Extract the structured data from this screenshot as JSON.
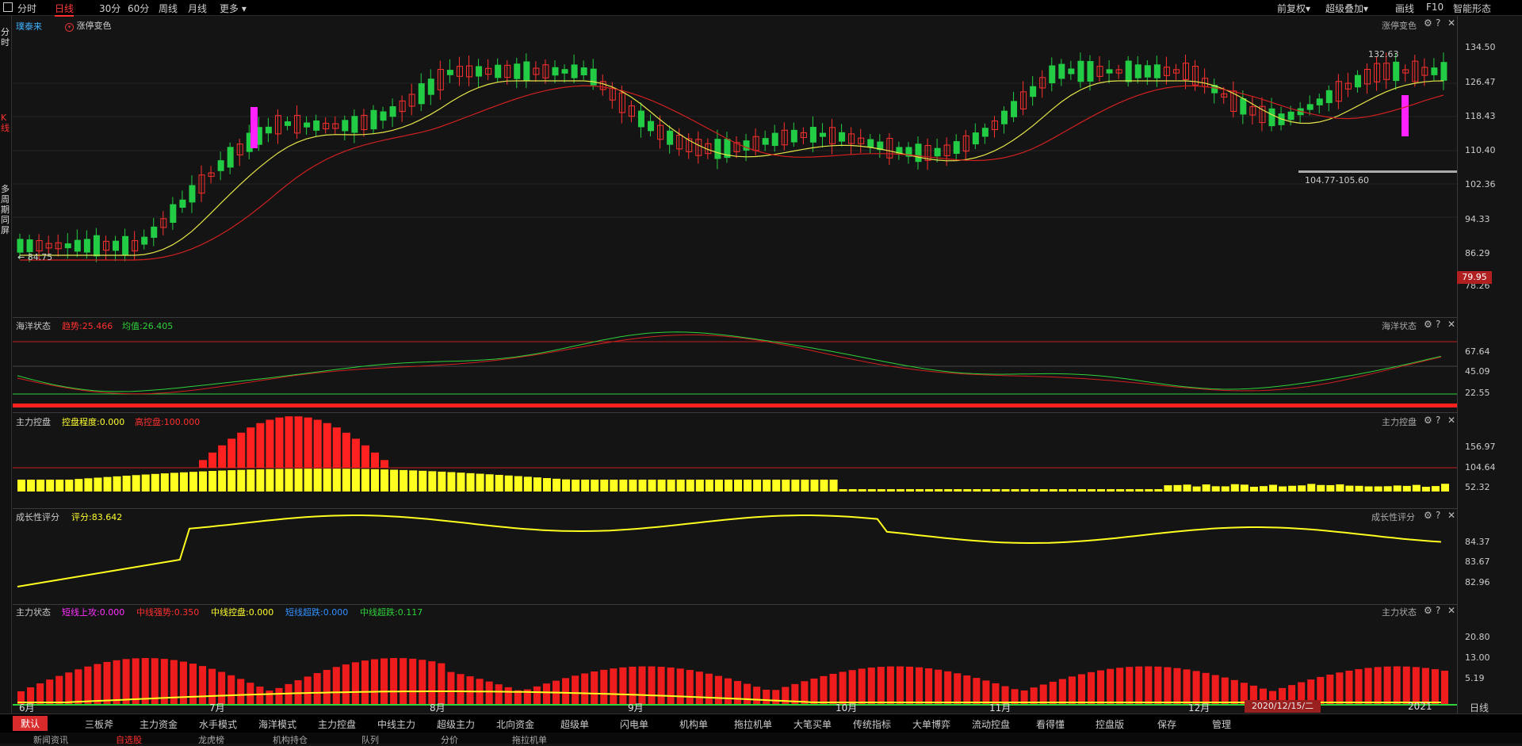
{
  "toolbar": {
    "periods": [
      "分时",
      "日线",
      "30分",
      "60分",
      "周线",
      "月线",
      "更多"
    ],
    "active_period": "日线",
    "right": [
      "前复权",
      "超级叠加",
      "画线",
      "F10",
      "智能形态"
    ]
  },
  "left_strip": {
    "items": [
      "分时",
      "K线",
      "多周期同屏"
    ]
  },
  "main_panel": {
    "name": "璞泰来",
    "indicator": "涨停变色",
    "right_title": "涨停变色",
    "high_label": "132.63",
    "low_label": "84.75",
    "range_label": "104.77-105.60",
    "price_tag": "79.95",
    "y_ticks": [
      "134.50",
      "126.47",
      "118.43",
      "110.40",
      "102.36",
      "94.33",
      "86.29",
      "78.26"
    ]
  },
  "panel2": {
    "title": "海洋状态",
    "items": [
      {
        "label": "趋势:25.466",
        "color": "#ff3030"
      },
      {
        "label": "均值:26.405",
        "color": "#2ed23a"
      }
    ],
    "right_title": "海洋状态",
    "y_ticks": [
      "67.64",
      "45.09",
      "22.55"
    ]
  },
  "panel3": {
    "title": "主力控盘",
    "items": [
      {
        "label": "控盘程度:0.000",
        "color": "#ffff30"
      },
      {
        "label": "高控盘:100.000",
        "color": "#ff3030"
      }
    ],
    "right_title": "主力控盘",
    "y_ticks": [
      "156.97",
      "104.64",
      "52.32"
    ]
  },
  "panel4": {
    "title": "成长性评分",
    "items": [
      {
        "label": "评分:83.642",
        "color": "#ffff30"
      }
    ],
    "right_title": "成长性评分",
    "y_ticks": [
      "84.37",
      "83.67",
      "82.96"
    ]
  },
  "panel5": {
    "title": "主力状态",
    "items": [
      {
        "label": "短线上攻:0.000",
        "color": "#ff30ff"
      },
      {
        "label": "中线强势:0.350",
        "color": "#ff3030"
      },
      {
        "label": "中线控盘:0.000",
        "color": "#ffff30"
      },
      {
        "label": "短线超跌:0.000",
        "color": "#3090ff"
      },
      {
        "label": "中线超跌:0.117",
        "color": "#2ed23a"
      }
    ],
    "right_title": "主力状态",
    "y_ticks": [
      "20.80",
      "13.00",
      "5.19"
    ]
  },
  "x_axis": {
    "months": [
      "6月",
      "7月",
      "8月",
      "9月",
      "10月",
      "11月",
      "12月",
      "2021"
    ],
    "cursor_date": "2020/12/15/二",
    "period_btn": "日线"
  },
  "bottom_tabs": [
    "默认",
    "三板斧",
    "主力资金",
    "水手模式",
    "海洋模式",
    "主力控盘",
    "中线主力",
    "超级主力",
    "北向资金",
    "超级单",
    "闪电单",
    "机构单",
    "拖拉机单",
    "大笔买单",
    "传统指标",
    "大单博弈",
    "流动控盘",
    "看得懂",
    "控盘版",
    "保存",
    "管理"
  ],
  "last_tabs": [
    "新闻资讯",
    "自选股",
    "龙虎榜",
    "机构持仓",
    "队列",
    "分价",
    "拖拉机单"
  ],
  "colors": {
    "up": "#ff3030",
    "down": "#22cc44",
    "ma1": "#e6e64a",
    "ma2": "#d02020",
    "accent": "#ff3030",
    "limit": "#ff22ff"
  }
}
